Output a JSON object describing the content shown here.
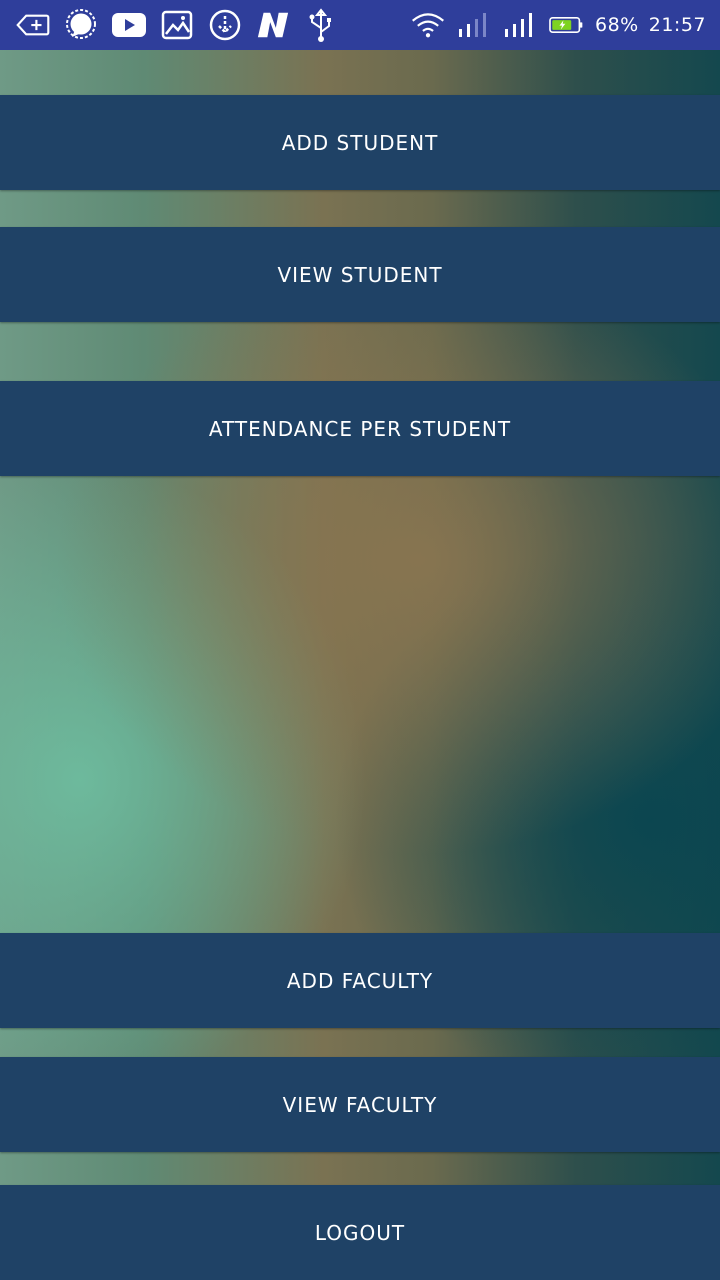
{
  "status_bar": {
    "battery_percent": "68%",
    "time": "21:57",
    "left_icons": [
      "add-tab-icon",
      "message-bubble-icon",
      "youtube-icon",
      "gallery-icon",
      "download-icon",
      "n-app-icon",
      "usb-icon"
    ],
    "right_icons": [
      "wifi-icon",
      "signal-1-icon",
      "signal-2-icon",
      "battery-charging-icon"
    ],
    "colors": {
      "background": "#2f3e9b",
      "battery": "#7ed321"
    }
  },
  "menu": {
    "add_student": "ADD STUDENT",
    "view_student": "VIEW STUDENT",
    "attendance_per_student": "ATTENDANCE PER STUDENT",
    "add_faculty": "ADD FACULTY",
    "view_faculty": "VIEW FACULTY",
    "logout": "LOGOUT"
  },
  "theme": {
    "button_background": "#1f4266",
    "button_text": "#ffffff"
  }
}
